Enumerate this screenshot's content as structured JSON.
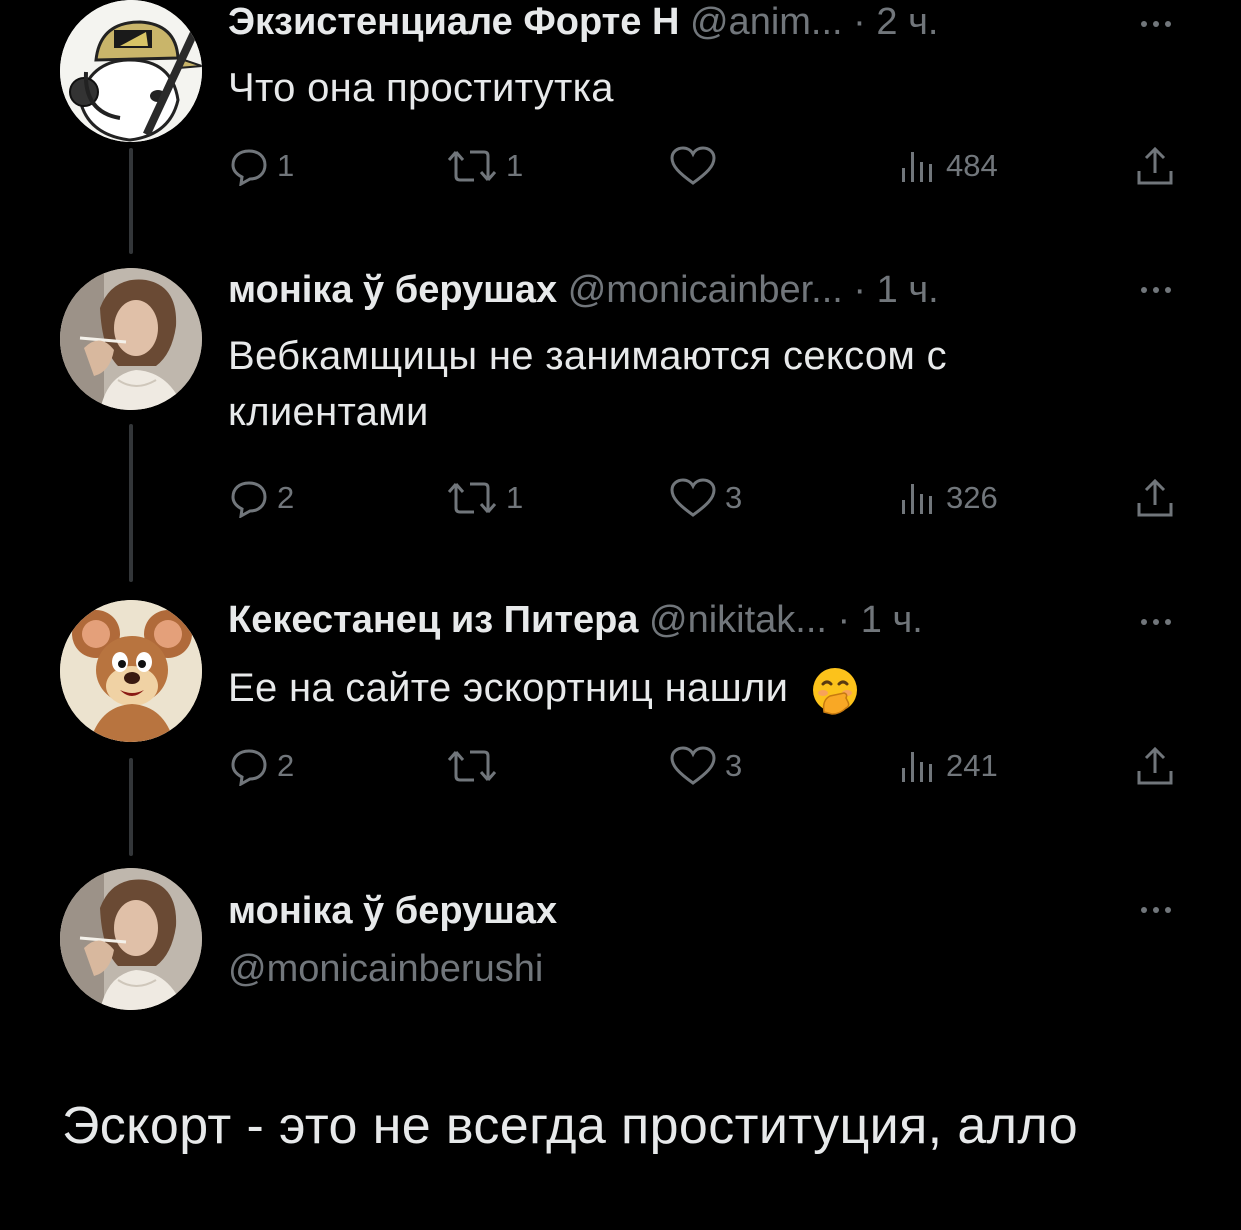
{
  "replies": [
    {
      "author_name": "Экзистенциале Форте Н",
      "handle": "@anim...",
      "time": "2 ч.",
      "text": "Что она проститутка",
      "reply_count": "1",
      "retweet_count": "1",
      "like_count": "",
      "view_count": "484",
      "avatar_icon": "cartoon-dog-cap-headset-avatar"
    },
    {
      "author_name": "моніка ў берушах",
      "handle": "@monicainber...",
      "time": "1 ч.",
      "text_line1": "Вебкамщицы не занимаются сексом с",
      "text_line2": "клиентами",
      "reply_count": "2",
      "retweet_count": "1",
      "like_count": "3",
      "view_count": "326",
      "avatar_icon": "woman-smoking-photo-avatar"
    },
    {
      "author_name": "Кекестанец из Питера",
      "handle": "@nikitak...",
      "time": "1 ч.",
      "text": "Ее на сайте эскортниц нашли",
      "emoji": "🤭",
      "reply_count": "2",
      "retweet_count": "",
      "like_count": "3",
      "view_count": "241",
      "avatar_icon": "jerry-mouse-cartoon-avatar"
    }
  ],
  "main_tweet": {
    "author_name": "моніка ў берушах",
    "handle": "@monicainberushi",
    "text": "Эскорт - это не всегда проституция, алло",
    "avatar_icon": "woman-smoking-photo-avatar"
  },
  "separator": "·",
  "colors": {
    "background": "#000000",
    "text": "#e7e9ea",
    "muted": "#71767b",
    "thread_line": "#333639"
  }
}
